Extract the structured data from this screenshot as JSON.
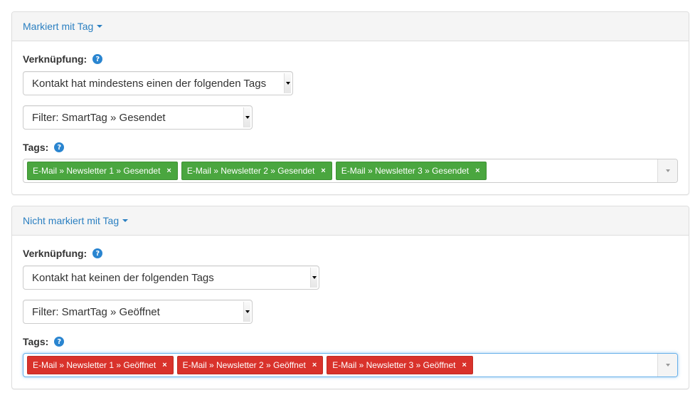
{
  "section1": {
    "heading": "Markiert mit Tag",
    "link_label": "Verknüpfung:",
    "link_select": "Kontakt hat mindestens einen der folgenden Tags",
    "filter_select": "Filter: SmartTag » Gesendet",
    "tags_label": "Tags:",
    "tags": [
      {
        "label": "E-Mail » Newsletter 1 » Gesendet",
        "remove": "×"
      },
      {
        "label": "E-Mail » Newsletter 2 » Gesendet",
        "remove": "×"
      },
      {
        "label": "E-Mail » Newsletter 3 » Gesendet",
        "remove": "×"
      }
    ],
    "tag_color": "#4aa63f"
  },
  "section2": {
    "heading": "Nicht markiert mit Tag",
    "link_label": "Verknüpfung:",
    "link_select": "Kontakt hat keinen der folgenden Tags",
    "filter_select": "Filter: SmartTag » Geöffnet",
    "tags_label": "Tags:",
    "tags": [
      {
        "label": "E-Mail » Newsletter 1 » Geöffnet",
        "remove": "×"
      },
      {
        "label": "E-Mail » Newsletter 2 » Geöffnet",
        "remove": "×"
      },
      {
        "label": "E-Mail » Newsletter 3 » Geöffnet",
        "remove": "×"
      }
    ],
    "tag_color": "#d9322b"
  },
  "help_glyph": "?",
  "colors": {
    "link": "#2a7fc1",
    "help": "#2a85d0",
    "focus": "#66afe9"
  }
}
